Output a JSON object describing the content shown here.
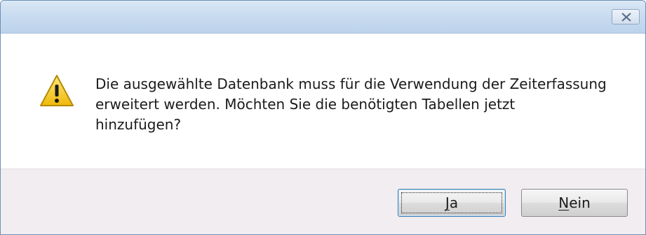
{
  "dialog": {
    "title": "",
    "message": "Die ausgewählte Datenbank muss für die Verwendung der Zeiterfassung\nerweitert werden. Möchten Sie die benötigten Tabellen jetzt\nhinzufügen?",
    "icon": "warning-icon"
  },
  "buttons": {
    "yes": {
      "mnemonic": "J",
      "rest": "a"
    },
    "no": {
      "mnemonic": "N",
      "rest": "ein"
    }
  },
  "colors": {
    "titlebar": "#c9dcf0",
    "footer": "#f1edf1",
    "warning_fill": "#f5c518",
    "focus_border": "#3c7fb1"
  }
}
